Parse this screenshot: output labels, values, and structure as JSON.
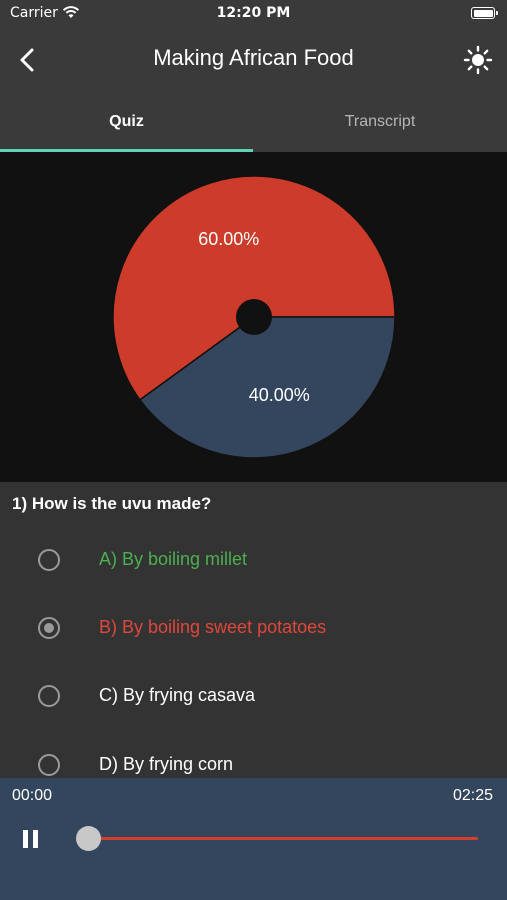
{
  "status_bar": {
    "carrier": "Carrier",
    "time": "12:20 PM"
  },
  "nav": {
    "title": "Making African Food",
    "back_icon": "chevron-left-icon",
    "right_icon": "brightness-icon"
  },
  "tabs": [
    {
      "label": "Quiz",
      "active": true
    },
    {
      "label": "Transcript",
      "active": false
    }
  ],
  "chart_data": {
    "type": "pie",
    "slices": [
      {
        "label": "60.00%",
        "value": 60,
        "color": "#cd3b2b"
      },
      {
        "label": "40.00%",
        "value": 40,
        "color": "#34465e"
      }
    ],
    "hole": true
  },
  "quiz": {
    "question": "1) How is the uvu made?",
    "options": [
      {
        "label": "A) By boiling millet",
        "color": "#4caf50",
        "selected": false
      },
      {
        "label": "B) By boiling sweet potatoes",
        "color": "#e0463a",
        "selected": true
      },
      {
        "label": "C) By frying casava",
        "color": "#ffffff",
        "selected": false
      },
      {
        "label": "D) By frying corn",
        "color": "#ffffff",
        "selected": false
      }
    ]
  },
  "player": {
    "current_time": "00:00",
    "total_time": "02:25",
    "progress": 0,
    "play_state_icon": "pause-icon",
    "accent_color": "#d2402d"
  }
}
